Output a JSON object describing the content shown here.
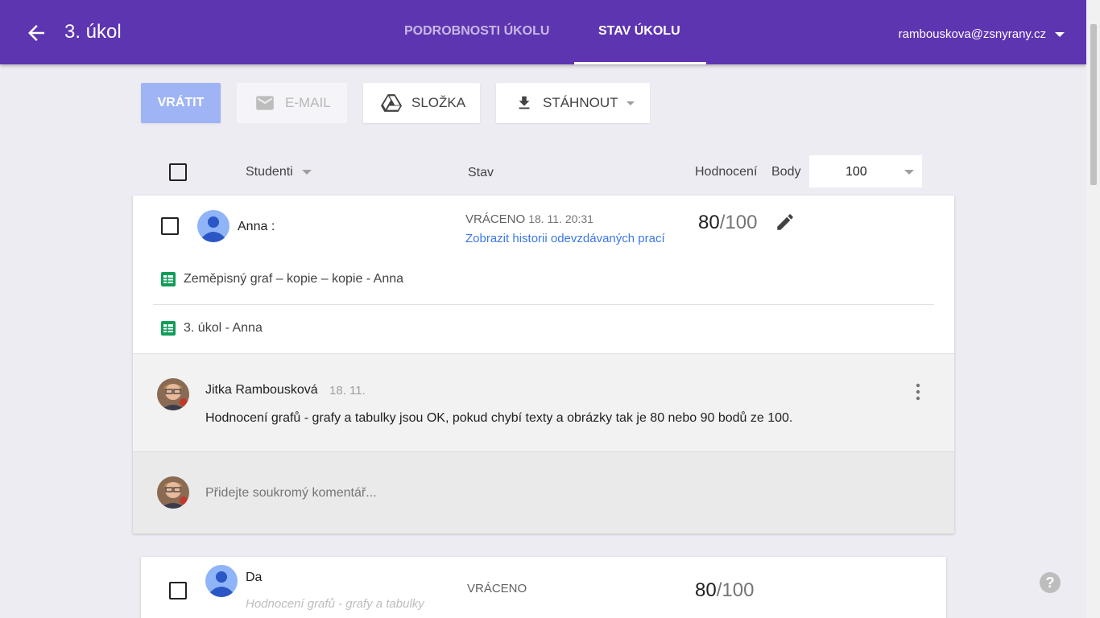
{
  "header": {
    "title": "3. úkol",
    "tabs": [
      {
        "label": "PODROBNOSTI ÚKOLU"
      },
      {
        "label": "STAV ÚKOLU"
      }
    ],
    "account": "rambouskova@zsnyrany.cz"
  },
  "toolbar": {
    "return_label": "VRÁTIT",
    "email_label": "E-MAIL",
    "folder_label": "SLOŽKA",
    "download_label": "STÁHNOUT"
  },
  "table": {
    "col_students": "Studenti",
    "col_status": "Stav",
    "col_grade": "Hodnocení",
    "col_points": "Body",
    "points_value": "100"
  },
  "students": [
    {
      "name": "Anna :",
      "status": "VRÁCENO",
      "status_date": "18. 11. 20:31",
      "history_link": "Zobrazit historii odevzdávaných prací",
      "grade_num": "80",
      "grade_den": "/100",
      "files": [
        "Zeměpisný graf – kopie – kopie - Anna",
        "3. úkol - Anna"
      ],
      "comment": {
        "author": "Jitka Rambousková",
        "date": "18. 11.",
        "text": "Hodnocení grafů - grafy a tabulky jsou OK, pokud chybí texty a obrázky tak je 80 nebo 90 bodů ze 100."
      },
      "private_placeholder": "Přidejte soukromý komentář..."
    },
    {
      "name": "Da",
      "preview": "Hodnocení grafů - grafy a tabulky",
      "status": "VRÁCENO",
      "grade_num": "80",
      "grade_den": "/100"
    }
  ],
  "colors": {
    "header": "#5e35b1",
    "link": "#3b78e7",
    "return_button": "#9fb4f5",
    "sheets_icon": "#0f9d58"
  },
  "icons": [
    "back-arrow-icon",
    "dropdown-icon",
    "mail-icon",
    "drive-icon",
    "download-icon",
    "pencil-icon",
    "sheets-icon",
    "more-vert-icon",
    "help-icon"
  ]
}
